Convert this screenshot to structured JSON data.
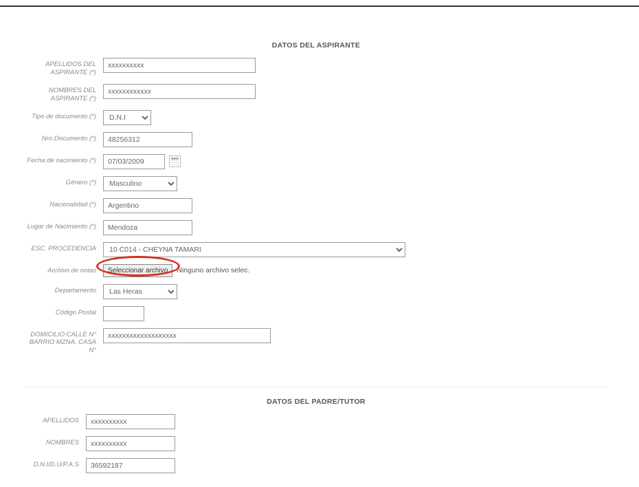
{
  "sectionA": {
    "title": "DATOS DEL ASPIRANTE",
    "labels": {
      "apellidos": "APELLIDOS DEL ASPIRANTE (*)",
      "nombres": "NOMBRES DEL ASPIRANTE (*)",
      "tipoDoc": "Tipo de documento (*)",
      "nroDoc": "Nro Documento (*)",
      "fechaNac": "Fecha de nacimiento (*)",
      "genero": "Género (*)",
      "nacionalidad": "Nacionalidad (*)",
      "lugarNac": "Lugar de Nacimiento (*)",
      "escProc": "ESC. PROCEDENCIA",
      "archivoNotas": "Archivo de notas",
      "departamento": "Departamento",
      "codigoPostal": "Código Postal",
      "domicilio": "DOMICILIO:CALLE N° BARRIO MZNA. CASA N°"
    },
    "values": {
      "apellidos": "xxxxxxxxxx",
      "nombres": "xxxxxxxxxxxx",
      "tipoDoc": "D.N.I",
      "nroDoc": "48256312",
      "fechaNac": "07/03/2009",
      "genero": "Masculino",
      "nacionalidad": "Argentino",
      "lugarNac": "Mendoza",
      "escProc": "10 C014 - CHEYNA TAMARI",
      "archivoBtn": "Seleccionar archivo",
      "archivoStatus": "Ninguno archivo selec.",
      "departamento": "Las Heras",
      "codigoPostal": "",
      "domicilio": "xxxxxxxxxxxxxxxxxxx"
    }
  },
  "sectionB": {
    "title": "DATOS DEL PADRE/TUTOR",
    "labels": {
      "apellidos": "APELLIDOS",
      "nombres": "NOMBRES",
      "dni": "D.N.I/D.U/P.A.S"
    },
    "values": {
      "apellidos": "xxxxxxxxxx",
      "nombres": "xxxxxxxxxx",
      "dni": "36592187"
    }
  }
}
